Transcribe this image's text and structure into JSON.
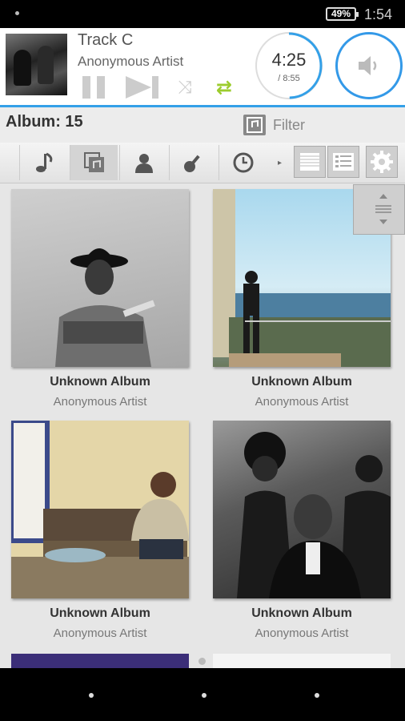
{
  "status": {
    "battery": "49%",
    "time": "1:54"
  },
  "player": {
    "track_title": "Track C",
    "track_artist": "Anonymous Artist",
    "time_current": "4:25",
    "time_total": "/ 8:55",
    "progress": 0.496,
    "accent": "#33a0e8",
    "repeat_color": "#9ccc2e",
    "icons": [
      "pause-icon",
      "next-icon",
      "shuffle-icon",
      "repeat-icon",
      "volume-icon"
    ]
  },
  "header": {
    "album_count": "Album: 15",
    "filter_label": "Filter"
  },
  "toolbar": {
    "tabs": [
      "songs-icon",
      "albums-icon",
      "artists-icon",
      "genres-icon",
      "recent-icon"
    ],
    "active_tab": "albums-icon",
    "views": [
      "list-dense-icon",
      "list-detail-icon",
      "settings-icon"
    ]
  },
  "albums": [
    {
      "title": "Unknown Album",
      "artist": "Anonymous Artist"
    },
    {
      "title": "Unknown Album",
      "artist": "Anonymous Artist"
    },
    {
      "title": "Unknown Album",
      "artist": "Anonymous Artist"
    },
    {
      "title": "Unknown Album",
      "artist": "Anonymous Artist"
    }
  ]
}
